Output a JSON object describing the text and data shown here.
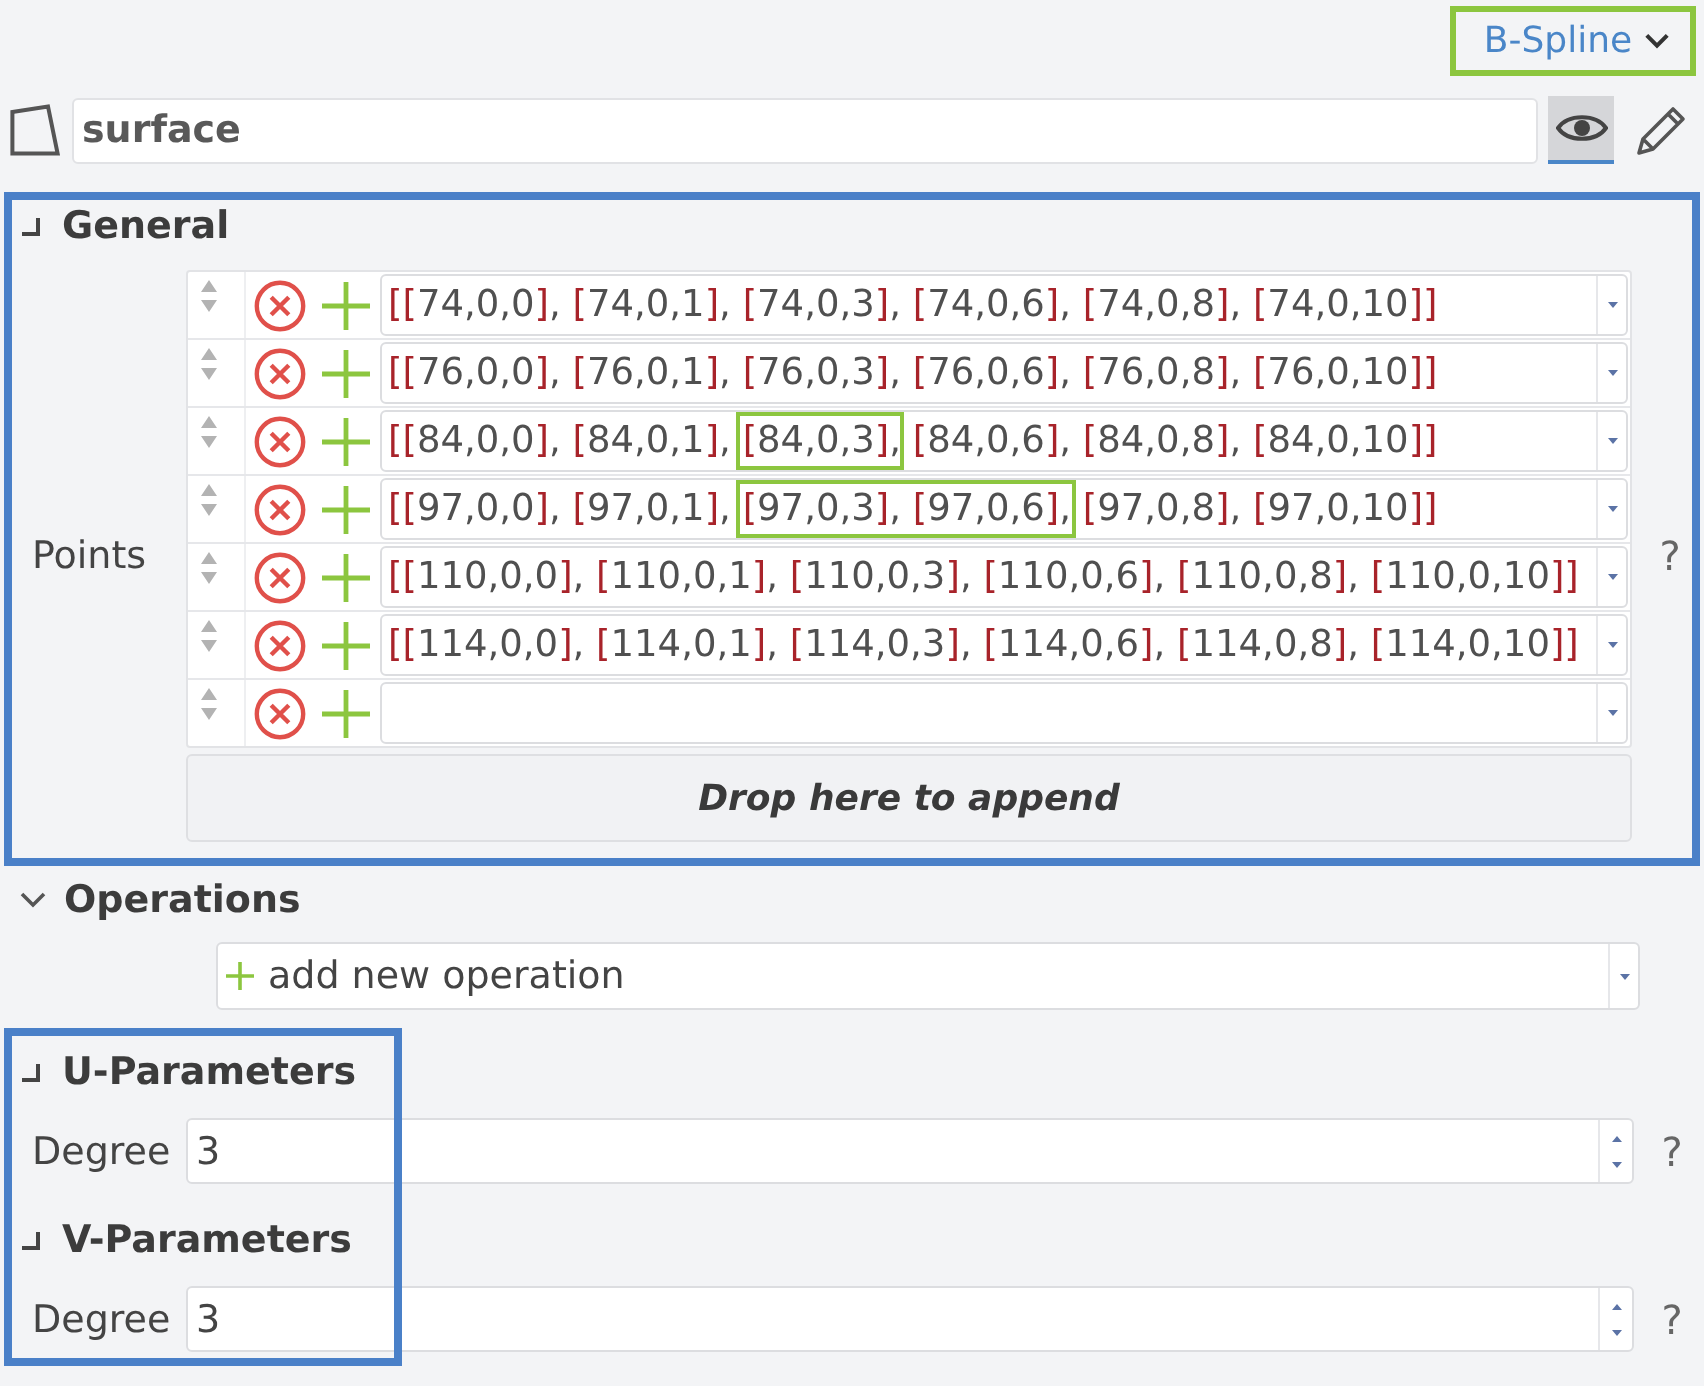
{
  "type_selector": {
    "value": "B-Spline",
    "highlighted": true
  },
  "object": {
    "name": "surface",
    "view_active": true
  },
  "groups": [
    {
      "highlighted": true,
      "highlight_full_width": true,
      "sections": [
        {
          "title": "General",
          "collapsible": false,
          "fields": [
            {
              "kind": "point_list",
              "label": "Points",
              "help": "?",
              "drop_zone": "Drop here to append",
              "rows": [
                {
                  "kind": "point",
                  "segments": [
                    {
                      "text": "[[74,0,0], [74,0,1], [74,0,3], [74,0,6], [74,0,8], [74,0,10]]",
                      "highlighted": false
                    }
                  ]
                },
                {
                  "kind": "point",
                  "segments": [
                    {
                      "text": "[[76,0,0], [76,0,1], [76,0,3], [76,0,6], [76,0,8], [76,0,10]]",
                      "highlighted": false
                    }
                  ]
                },
                {
                  "kind": "point",
                  "segments": [
                    {
                      "text": "[[84,0,0], [84,0,1], ",
                      "highlighted": false
                    },
                    {
                      "text": "[84,0,3],",
                      "highlighted": true
                    },
                    {
                      "text": " [84,0,6], [84,0,8], [84,0,10]]",
                      "highlighted": false
                    }
                  ]
                },
                {
                  "kind": "point",
                  "segments": [
                    {
                      "text": "[[97,0,0], [97,0,1], ",
                      "highlighted": false
                    },
                    {
                      "text": "[97,0,3], [97,0,6],",
                      "highlighted": true
                    },
                    {
                      "text": " [97,0,8], [97,0,10]]",
                      "highlighted": false
                    }
                  ]
                },
                {
                  "kind": "point",
                  "segments": [
                    {
                      "text": "[[110,0,0], [110,0,1], [110,0,3], [110,0,6], [110,0,8], [110,0,10]]",
                      "highlighted": false
                    }
                  ]
                },
                {
                  "kind": "point",
                  "segments": [
                    {
                      "text": "[[114,0,0], [114,0,1], [114,0,3], [114,0,6], [114,0,8], [114,0,10]]",
                      "highlighted": false
                    }
                  ]
                },
                {
                  "kind": "blank"
                }
              ]
            }
          ]
        }
      ]
    },
    {
      "highlighted": false,
      "sections": [
        {
          "title": "Operations",
          "collapsible": true,
          "expanded": true,
          "fields": [
            {
              "kind": "add_select",
              "value": "add new operation"
            }
          ]
        }
      ]
    },
    {
      "highlighted": true,
      "highlight_full_width": false,
      "sections": [
        {
          "title": "U-Parameters",
          "collapsible": false,
          "fields": [
            {
              "kind": "number",
              "label": "Degree",
              "value": "3",
              "help": "?"
            }
          ]
        },
        {
          "title": "V-Parameters",
          "collapsible": false,
          "fields": [
            {
              "kind": "number",
              "label": "Degree",
              "value": "3",
              "help": "?"
            }
          ]
        }
      ]
    }
  ]
}
